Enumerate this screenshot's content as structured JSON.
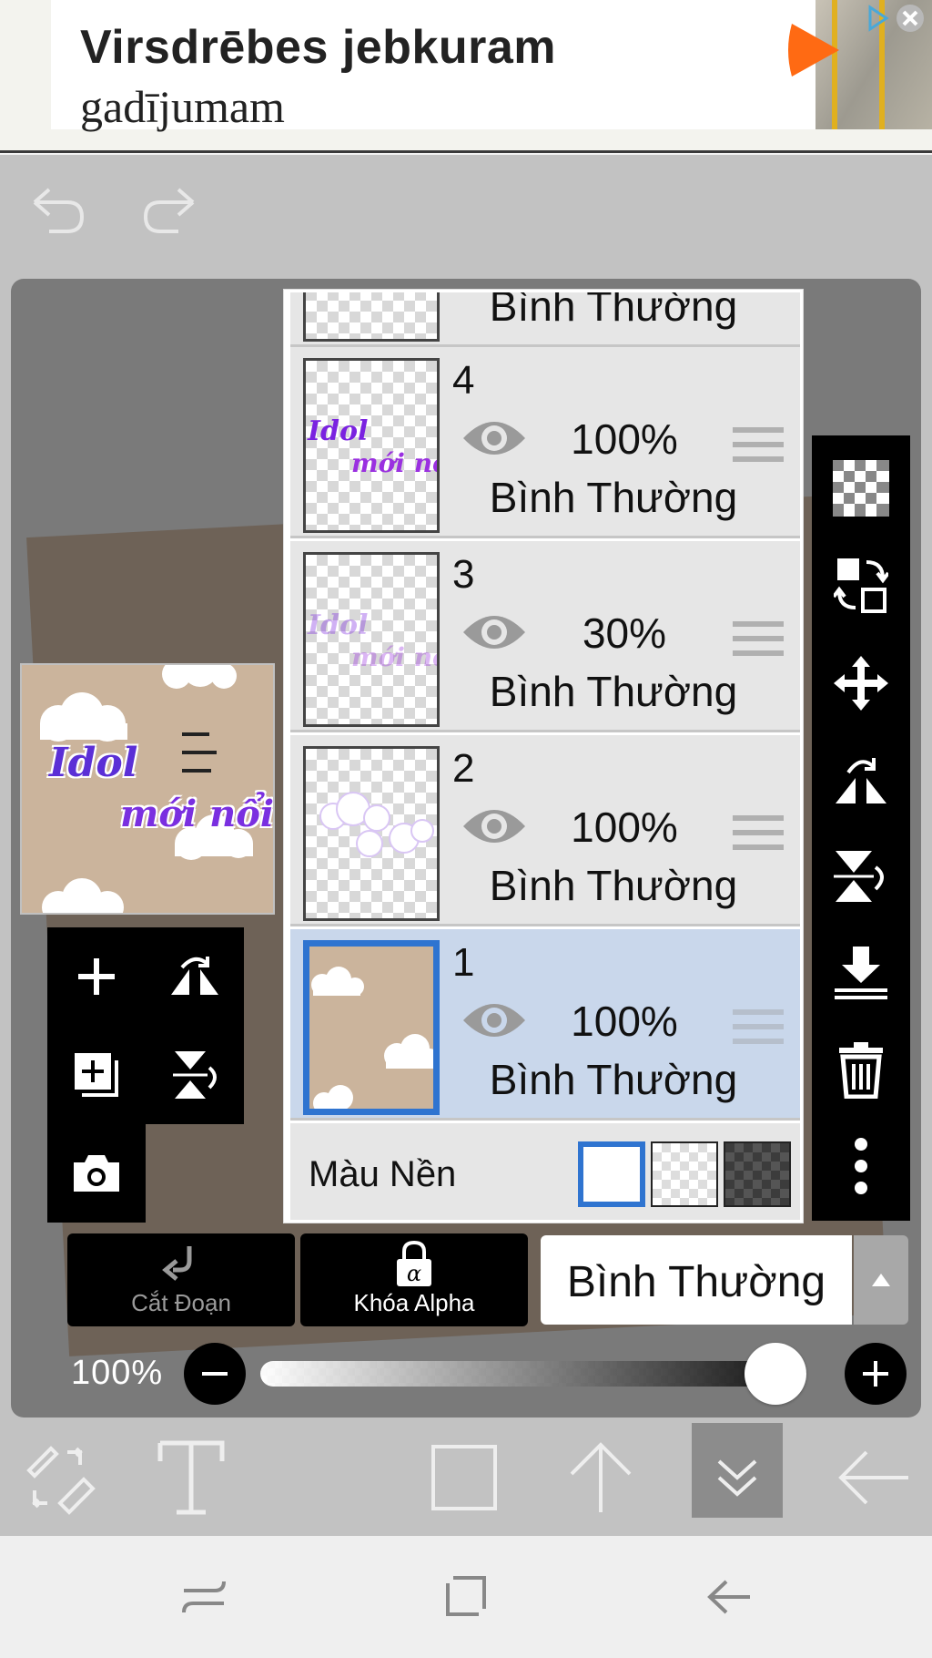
{
  "ad": {
    "line1": "Virsdrēbes jebkuram",
    "line2": "gadījumam",
    "brand_color": "#ff6a13"
  },
  "toolbar": {
    "undo_icon": "undo-icon",
    "redo_icon": "redo-icon"
  },
  "preview": {
    "title_line1": "Idol",
    "title_line2": "mới nổi"
  },
  "layers": {
    "top_partial_blend": "Bình Thường",
    "items": [
      {
        "number": "4",
        "opacity": "100%",
        "blend": "Bình Thường",
        "thumb_text1": "Idol",
        "thumb_text2": "mới nổ",
        "selected": false
      },
      {
        "number": "3",
        "opacity": "30%",
        "blend": "Bình Thường",
        "thumb_text1": "Idol",
        "thumb_text2": "mới nổ",
        "selected": false
      },
      {
        "number": "2",
        "opacity": "100%",
        "blend": "Bình Thường",
        "selected": false
      },
      {
        "number": "1",
        "opacity": "100%",
        "blend": "Bình Thường",
        "selected": true
      }
    ],
    "background_label": "Màu Nền"
  },
  "modes": {
    "clip_label": "Cắt Đoạn",
    "alpha_label": "Khóa Alpha",
    "blend_mode": "Bình Thường"
  },
  "opacity": {
    "label": "100%",
    "value": 1.0
  },
  "colors": {
    "selected_border": "#2f74d0",
    "selected_row": "#c9d7eb",
    "canvas_bg": "#cbb49c"
  }
}
